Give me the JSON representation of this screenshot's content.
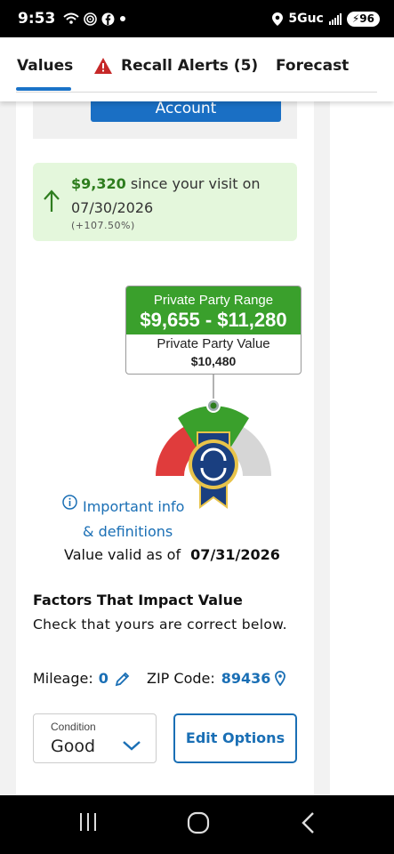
{
  "status_bar": {
    "time": "9:53",
    "network": "5Guc",
    "battery": "96"
  },
  "tabs": [
    {
      "label": "Values",
      "active": true
    },
    {
      "label": "Recall Alerts (5)",
      "icon": "warning-icon"
    },
    {
      "label": "Forecast"
    }
  ],
  "account_button": {
    "label": "Account"
  },
  "value_change": {
    "amount": "$9,320",
    "text": " since your visit on",
    "date": "07/30/2026",
    "percent": "(+107.50%)"
  },
  "range": {
    "label": "Private Party Range",
    "value": "$9,655 - $11,280",
    "ppv_label": "Private Party Value",
    "ppv_value": "$10,480"
  },
  "info_link": {
    "line1": "Important info",
    "line2": "& definitions"
  },
  "valid": {
    "label": "Value valid as of",
    "date": "07/31/2026"
  },
  "factors": {
    "title": "Factors That Impact Value",
    "subtitle": "Check that yours are correct below.",
    "mileage_label": "Mileage:",
    "mileage_value": "0",
    "zip_label": "ZIP Code:",
    "zip_value": "89436",
    "condition_label": "Condition",
    "condition_value": "Good",
    "edit_button": "Edit Options"
  },
  "colors": {
    "accent_blue": "#1a6fb5",
    "green": "#3aa02c",
    "gain_green": "#2e7d1e",
    "warning_red": "#c62828"
  }
}
